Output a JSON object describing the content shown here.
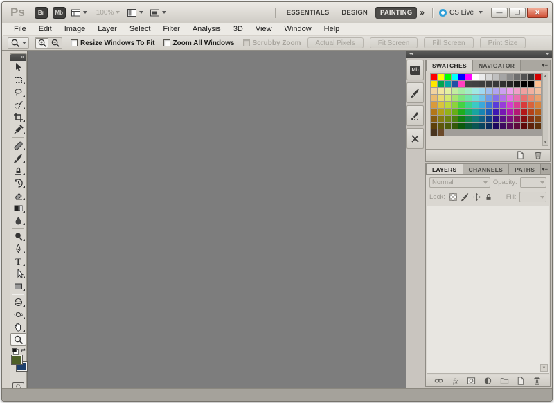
{
  "window": {
    "app_logo": "Ps",
    "controls": {
      "minimize": "—",
      "restore": "❐",
      "close": "✕"
    }
  },
  "titlebar": {
    "bridge_label": "Br",
    "mini_bridge_label": "Mb",
    "zoom_level": "100%",
    "workspaces": [
      "ESSENTIALS",
      "DESIGN",
      "PAINTING"
    ],
    "active_workspace": "PAINTING",
    "workspace_overflow": "»",
    "cs_live_label": "CS Live"
  },
  "menubar": {
    "items": [
      "File",
      "Edit",
      "Image",
      "Layer",
      "Select",
      "Filter",
      "Analysis",
      "3D",
      "View",
      "Window",
      "Help"
    ]
  },
  "options": {
    "checkboxes": [
      {
        "label": "Resize Windows To Fit",
        "checked": false,
        "disabled": false
      },
      {
        "label": "Zoom All Windows",
        "checked": false,
        "disabled": false
      },
      {
        "label": "Scrubby Zoom",
        "checked": false,
        "disabled": true
      }
    ],
    "buttons": [
      {
        "label": "Actual Pixels",
        "disabled": true
      },
      {
        "label": "Fit Screen",
        "disabled": true
      },
      {
        "label": "Fill Screen",
        "disabled": true
      },
      {
        "label": "Print Size",
        "disabled": true
      }
    ]
  },
  "toolbar": {
    "tools": [
      {
        "name": "move"
      },
      {
        "name": "rectangular-marquee",
        "flyout": true
      },
      {
        "name": "lasso",
        "flyout": true
      },
      {
        "name": "quick-selection",
        "flyout": true
      },
      {
        "name": "crop",
        "flyout": true
      },
      {
        "name": "eyedropper",
        "flyout": true
      },
      {
        "separator": true
      },
      {
        "name": "spot-healing-brush",
        "flyout": true
      },
      {
        "name": "brush",
        "flyout": true
      },
      {
        "name": "clone-stamp",
        "flyout": true
      },
      {
        "name": "history-brush",
        "flyout": true
      },
      {
        "name": "eraser",
        "flyout": true
      },
      {
        "name": "gradient",
        "flyout": true
      },
      {
        "name": "blur",
        "flyout": true
      },
      {
        "separator": true
      },
      {
        "name": "dodge",
        "flyout": true
      },
      {
        "name": "pen",
        "flyout": true
      },
      {
        "name": "type",
        "flyout": true
      },
      {
        "name": "path-selection",
        "flyout": true
      },
      {
        "name": "rectangle",
        "flyout": true
      },
      {
        "separator": true
      },
      {
        "name": "3d-object-rotate",
        "flyout": true
      },
      {
        "name": "3d-camera-rotate",
        "flyout": true
      },
      {
        "name": "hand",
        "flyout": true
      },
      {
        "name": "zoom",
        "selected": true
      }
    ],
    "foreground_color": "#4d5f28",
    "background_color": "#1d3f6d"
  },
  "dock": {
    "icon_buttons": [
      "mini-bridge",
      "brush-panel",
      "brush-presets",
      "tool-presets"
    ]
  },
  "swatches_panel": {
    "tabs": [
      "SWATCHES",
      "NAVIGATOR"
    ],
    "active_tab": "SWATCHES",
    "grid": [
      [
        "#ff0000",
        "#ffff00",
        "#00ff00",
        "#00ffff",
        "#0000ff",
        "#ff00ff",
        "#ffffff",
        "#ebebeb",
        "#d6d6d6",
        "#c0c0c0",
        "#a5a5a5",
        "#8a8a8a",
        "#6e6e6e",
        "#525252",
        "#373737",
        "#d40000"
      ],
      [
        "#ffe800",
        "#00a550",
        "#00a5a5",
        "#2050a5",
        "#ff40c0",
        "#434343",
        "#414141",
        "#3e3e3e",
        "#3b3b3b",
        "#383838",
        "#303030",
        "#252525",
        "#151515",
        "#000000",
        "#000000",
        "#ffc091"
      ],
      [
        "#f2d3a0",
        "#f2e6a0",
        "#e4f0a0",
        "#c2eca0",
        "#a4eca4",
        "#a0ecc4",
        "#a0e8e4",
        "#a0d8f0",
        "#a0bef0",
        "#b0a4f0",
        "#cca0f0",
        "#eca0ec",
        "#f0a0c8",
        "#f0a0a0",
        "#f0b0a0",
        "#f0c0a0"
      ],
      [
        "#eaba70",
        "#eadb70",
        "#d4ea70",
        "#a8e470",
        "#7ce47c",
        "#70e4a8",
        "#70dcd8",
        "#70c4ea",
        "#709cea",
        "#8470ea",
        "#b470ea",
        "#e470e4",
        "#ea70b0",
        "#ea7070",
        "#ea8c70",
        "#eaa270"
      ],
      [
        "#d99a3c",
        "#d9c43c",
        "#bcd93c",
        "#8cd33c",
        "#44d344",
        "#3cd38c",
        "#3cc9c4",
        "#3ca8d9",
        "#3c78d9",
        "#5a3cd9",
        "#983cd9",
        "#d33cd3",
        "#d93c94",
        "#d93c3c",
        "#d9633c",
        "#d9823c"
      ],
      [
        "#b37718",
        "#b3a018",
        "#93b318",
        "#68ad18",
        "#1ead1e",
        "#18ad68",
        "#18a4a0",
        "#1884b3",
        "#1858b3",
        "#3d18b3",
        "#7718b3",
        "#ad18ad",
        "#b31874",
        "#b31818",
        "#b34318",
        "#b35e18"
      ],
      [
        "#855a10",
        "#857b10",
        "#6d8510",
        "#4c8010",
        "#128012",
        "#10804c",
        "#107a77",
        "#106085",
        "#104085",
        "#2a1085",
        "#581085",
        "#801080",
        "#851055",
        "#851010",
        "#853010",
        "#854510"
      ],
      [
        "#5e400a",
        "#5e570a",
        "#4d5e0a",
        "#36590a",
        "#0c590c",
        "#0a5936",
        "#0a5553",
        "#0a445e",
        "#0a2d5e",
        "#1d0a5e",
        "#3e0a5e",
        "#590a59",
        "#5e0a3c",
        "#5e0a0a",
        "#5e220a",
        "#5e310a"
      ],
      [
        "#4a3520",
        "#6b4a2a"
      ]
    ]
  },
  "layers_panel": {
    "tabs": [
      "LAYERS",
      "CHANNELS",
      "PATHS"
    ],
    "active_tab": "LAYERS",
    "blend_mode": "Normal",
    "opacity_label": "Opacity:",
    "opacity_value": "",
    "lock_label": "Lock:",
    "fill_label": "Fill:",
    "fill_value": ""
  }
}
